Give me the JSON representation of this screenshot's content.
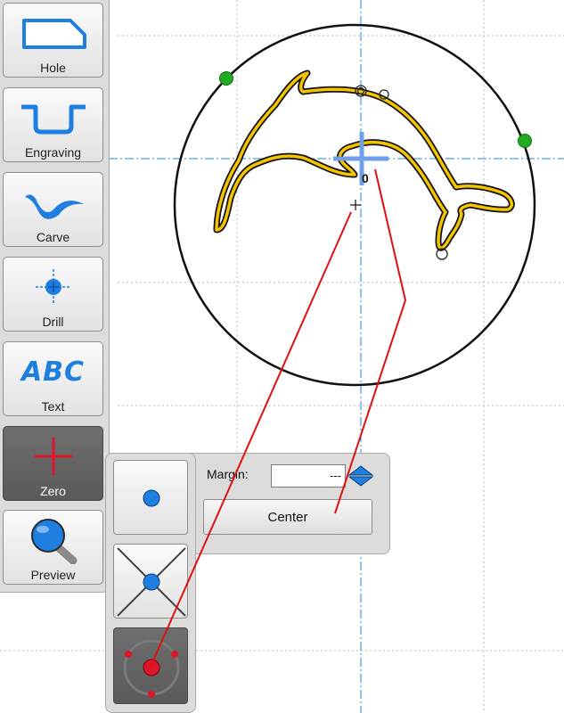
{
  "toolbar": {
    "items": [
      {
        "label": "Hole",
        "icon": "hole-icon"
      },
      {
        "label": "Engraving",
        "icon": "engraving-icon"
      },
      {
        "label": "Carve",
        "icon": "carve-icon"
      },
      {
        "label": "Drill",
        "icon": "drill-icon"
      },
      {
        "label": "Text",
        "icon": "text-icon",
        "icon_text": "ABC"
      },
      {
        "label": "Zero",
        "icon": "zero-icon",
        "active": true
      },
      {
        "label": "Preview",
        "icon": "preview-icon"
      }
    ]
  },
  "zero_panel": {
    "options": [
      {
        "icon": "point-icon"
      },
      {
        "icon": "intersection-icon"
      },
      {
        "icon": "circle-center-icon",
        "active": true
      }
    ],
    "margin_label": "Margin:",
    "margin_value": "---",
    "center_button_label": "Center"
  },
  "canvas": {
    "origin_label": "0"
  },
  "colors": {
    "accent_blue": "#1e7fe0",
    "guide_red": "#e01010",
    "outline_yellow": "#f5c400",
    "handle_green": "#22aa22"
  }
}
